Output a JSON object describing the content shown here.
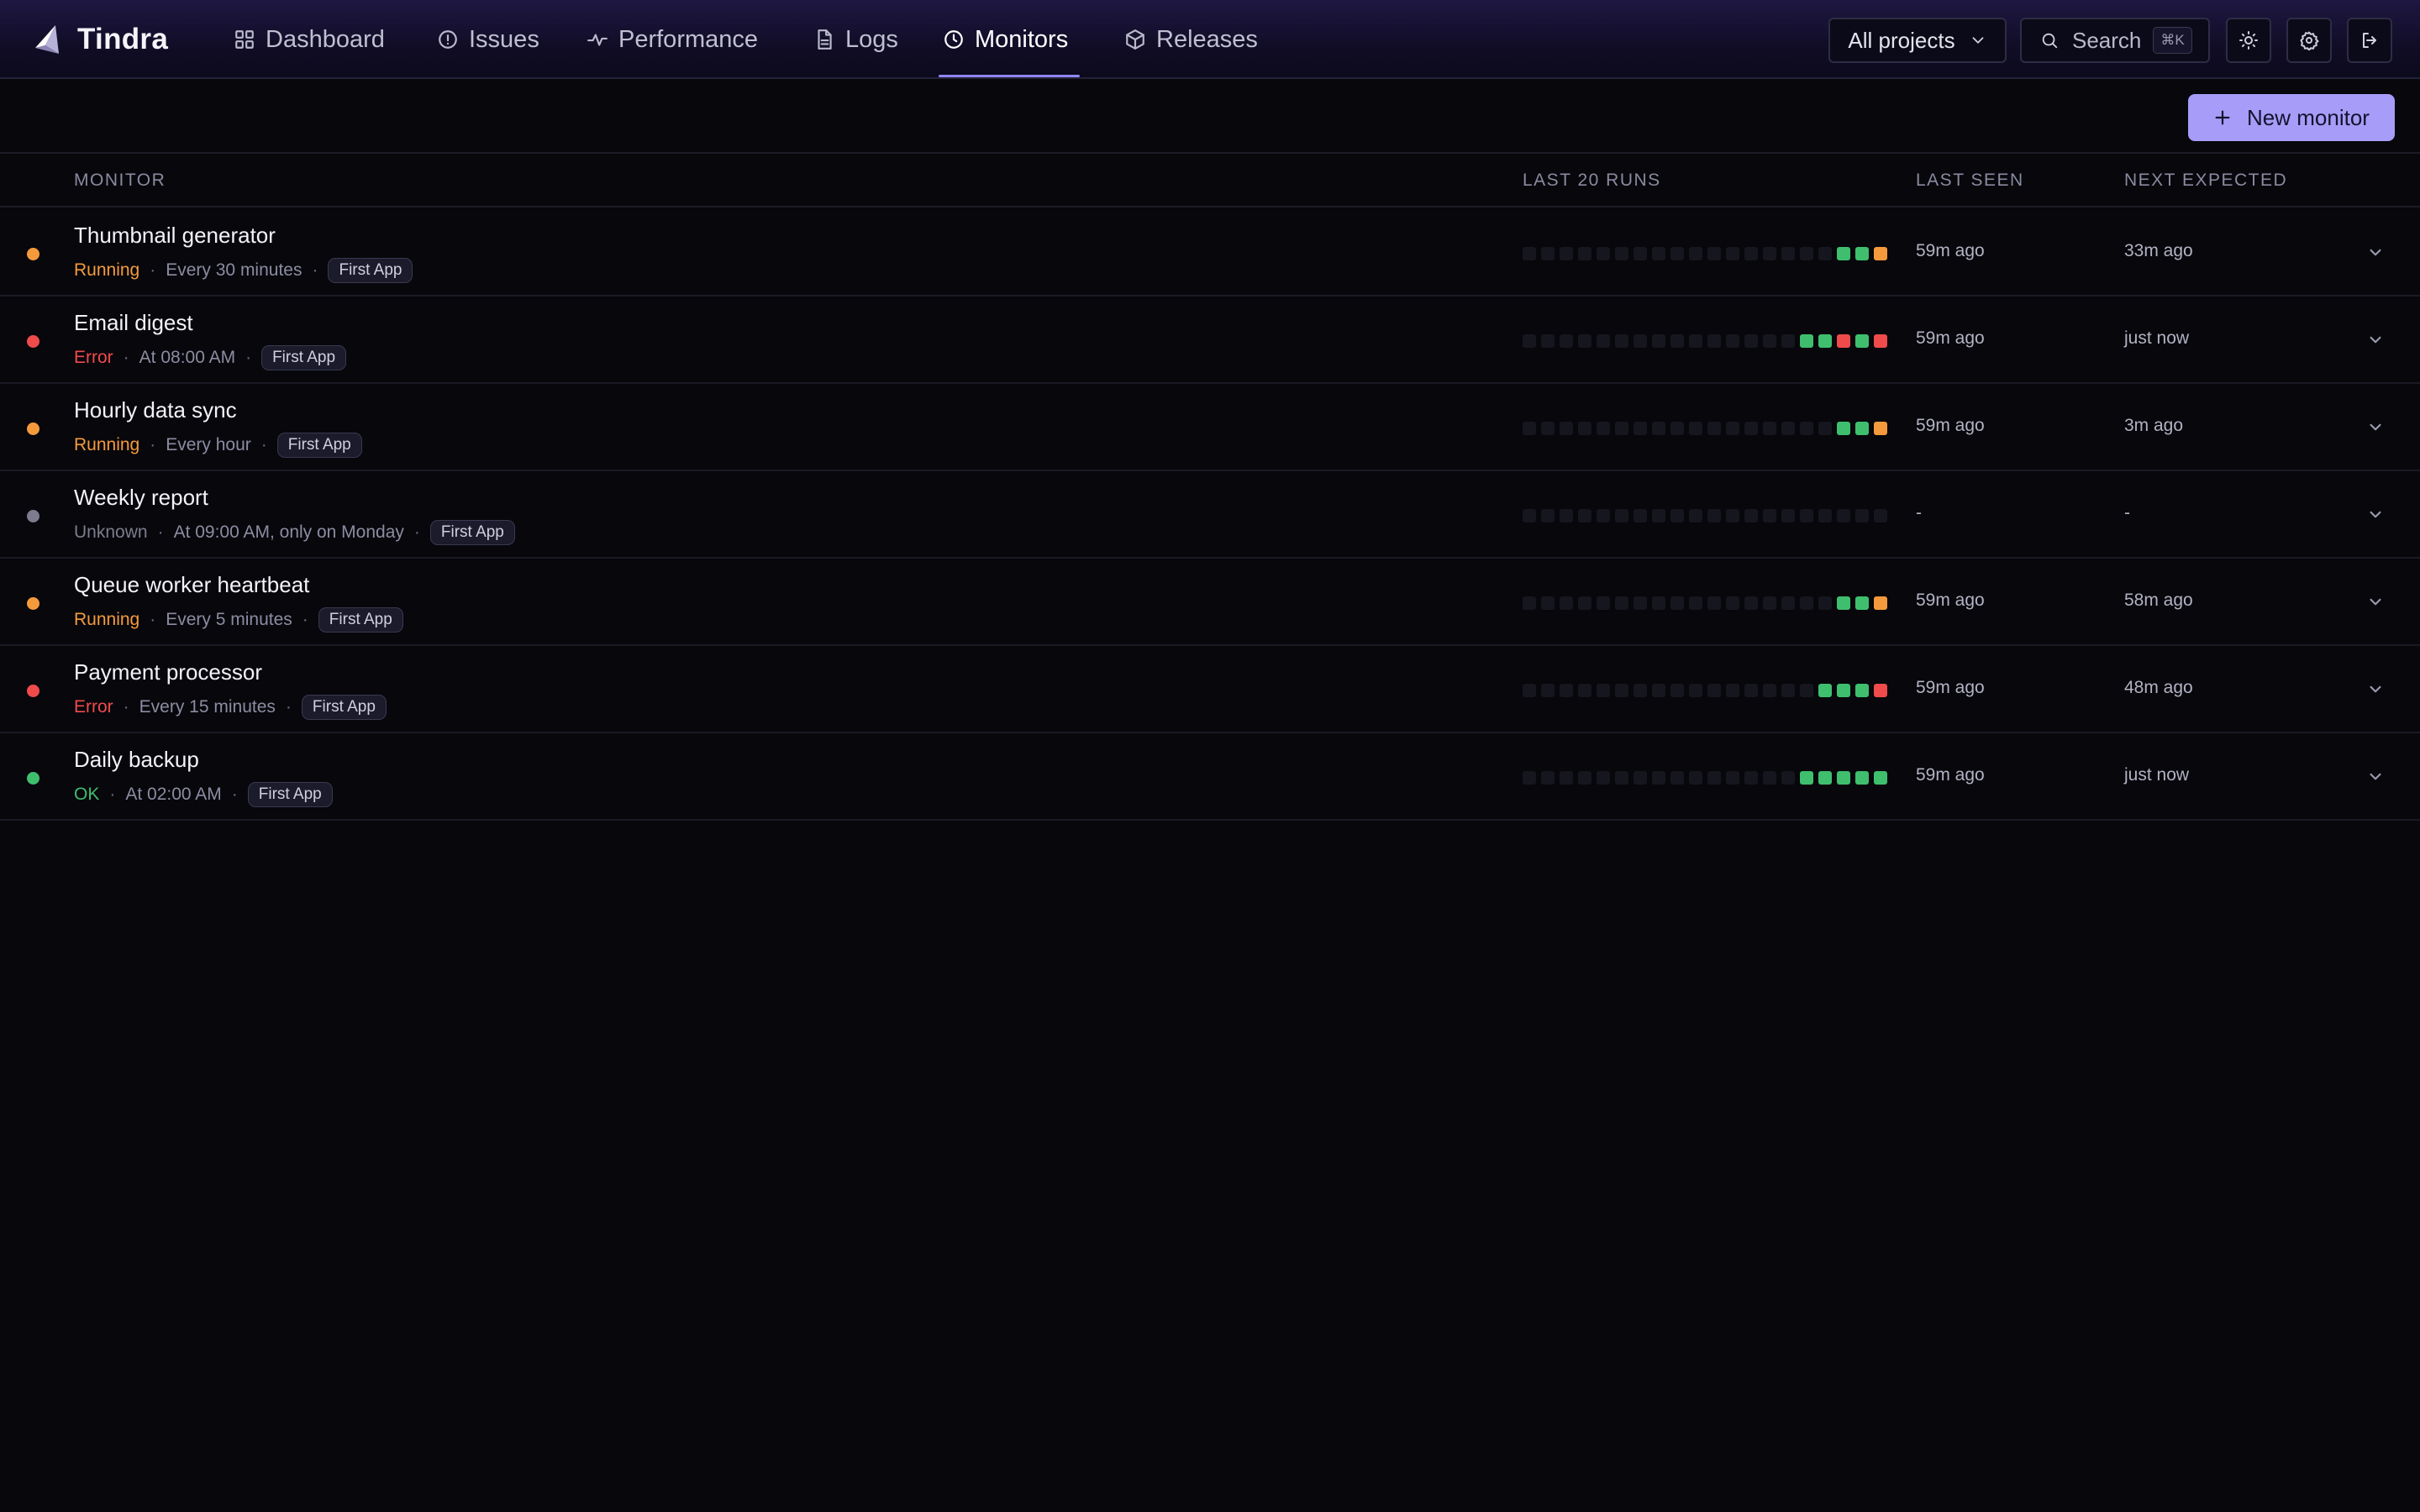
{
  "app": {
    "name": "Tindra"
  },
  "nav": {
    "tabs": [
      {
        "label": "Dashboard"
      },
      {
        "label": "Issues"
      },
      {
        "label": "Performance"
      },
      {
        "label": "Logs"
      },
      {
        "label": "Monitors",
        "active": true
      },
      {
        "label": "Releases"
      }
    ],
    "project_select": "All projects",
    "search": {
      "label": "Search",
      "shortcut": "⌘K"
    },
    "icons": [
      "sun-icon",
      "gear-icon",
      "logout-icon"
    ]
  },
  "toolbar": {
    "new_monitor_label": "New monitor"
  },
  "table": {
    "headers": {
      "monitor": "MONITOR",
      "runs": "LAST 20 RUNS",
      "last_seen": "LAST SEEN",
      "next_expected": "NEXT EXPECTED"
    },
    "rows": [
      {
        "name": "Thumbnail generator",
        "status": "Running",
        "status_color": "#f59a3c",
        "schedule": "Every 30 minutes",
        "project": "First App",
        "runs": [
          "ok",
          "ok",
          "running"
        ],
        "last_seen": "59m ago",
        "next_expected": "33m ago"
      },
      {
        "name": "Email digest",
        "status": "Error",
        "status_color": "#ef4b4b",
        "schedule": "At 08:00 AM",
        "project": "First App",
        "runs": [
          "ok",
          "ok",
          "error",
          "ok",
          "error"
        ],
        "last_seen": "59m ago",
        "next_expected": "just now"
      },
      {
        "name": "Hourly data sync",
        "status": "Running",
        "status_color": "#f59a3c",
        "schedule": "Every hour",
        "project": "First App",
        "runs": [
          "ok",
          "ok",
          "running"
        ],
        "last_seen": "59m ago",
        "next_expected": "3m ago"
      },
      {
        "name": "Weekly report",
        "status": "Unknown",
        "status_color": "#7c7c8e",
        "schedule": "At 09:00 AM, only on Monday",
        "project": "First App",
        "runs": [],
        "last_seen": "-",
        "next_expected": "-"
      },
      {
        "name": "Queue worker heartbeat",
        "status": "Running",
        "status_color": "#f59a3c",
        "schedule": "Every 5 minutes",
        "project": "First App",
        "runs": [
          "ok",
          "ok",
          "running"
        ],
        "last_seen": "59m ago",
        "next_expected": "58m ago"
      },
      {
        "name": "Payment processor",
        "status": "Error",
        "status_color": "#ef4b4b",
        "schedule": "Every 15 minutes",
        "project": "First App",
        "runs": [
          "ok",
          "ok",
          "ok",
          "error"
        ],
        "last_seen": "59m ago",
        "next_expected": "48m ago"
      },
      {
        "name": "Daily backup",
        "status": "OK",
        "status_color": "#3fbf6e",
        "schedule": "At 02:00 AM",
        "project": "First App",
        "runs": [
          "ok",
          "ok",
          "ok",
          "ok",
          "ok"
        ],
        "last_seen": "59m ago",
        "next_expected": "just now"
      }
    ]
  },
  "colors": {
    "accent": "#a79cf7",
    "run_ok": "#3fbf6e",
    "run_error": "#ef4b4b",
    "run_running": "#f59a3c",
    "run_empty": "#16161f"
  }
}
